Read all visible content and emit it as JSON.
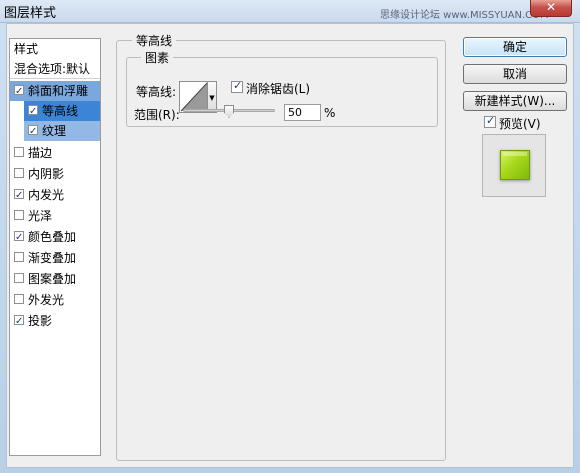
{
  "window": {
    "title": "图层样式",
    "watermark": "思缘设计论坛 www.MISSYUAN.COM",
    "close_glyph": "✕"
  },
  "styles_list": {
    "items": [
      {
        "label": "样式",
        "type": "header"
      },
      {
        "label": "混合选项:默认",
        "type": "header"
      },
      {
        "label": "斜面和浮雕",
        "checked": true,
        "state": "selected-parent"
      },
      {
        "label": "等高线",
        "checked": true,
        "state": "selected-current",
        "indent": true
      },
      {
        "label": "纹理",
        "checked": true,
        "state": "selected-sub",
        "indent": true
      },
      {
        "label": "描边",
        "checked": false
      },
      {
        "label": "内阴影",
        "checked": false
      },
      {
        "label": "内发光",
        "checked": true
      },
      {
        "label": "光泽",
        "checked": false
      },
      {
        "label": "颜色叠加",
        "checked": true
      },
      {
        "label": "渐变叠加",
        "checked": false
      },
      {
        "label": "图案叠加",
        "checked": false
      },
      {
        "label": "外发光",
        "checked": false
      },
      {
        "label": "投影",
        "checked": true
      }
    ]
  },
  "contour_panel": {
    "group_title": "等高线",
    "subgroup_title": "图素",
    "contour_label": "等高线:",
    "antialias_label": "消除锯齿(L)",
    "antialias_checked": true,
    "range_label": "范围(R):",
    "range_value": "50",
    "range_unit": "%",
    "range_slider_fraction": 0.5
  },
  "buttons": {
    "ok": "确定",
    "cancel": "取消",
    "new_style": "新建样式(W)...",
    "preview_label": "预览(V)",
    "preview_checked": true
  },
  "colors": {
    "selection": "#3c84d6",
    "preview_fill": "#a8d81a"
  }
}
